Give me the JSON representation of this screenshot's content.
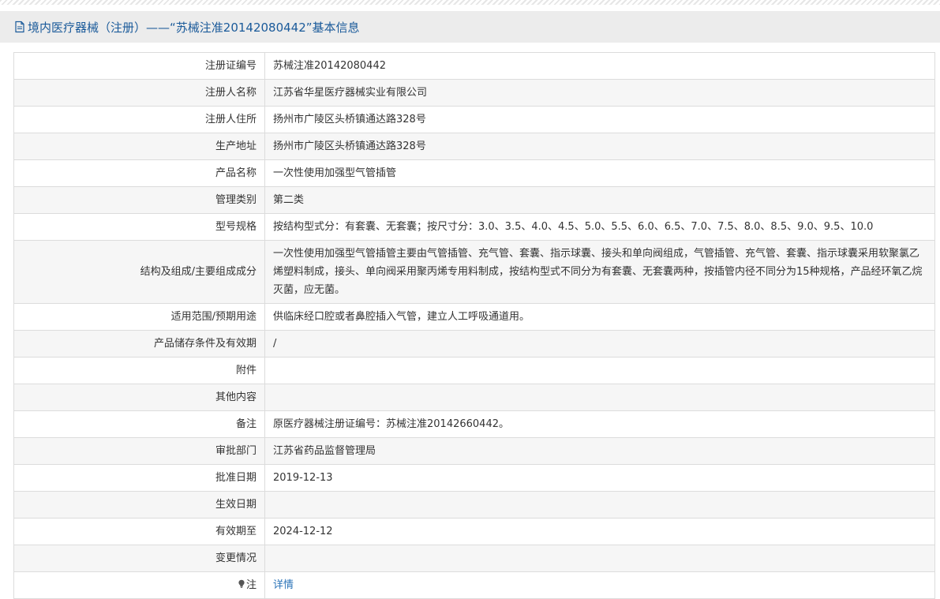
{
  "header": {
    "title": "境内医疗器械（注册）——“苏械注准20142080442”基本信息"
  },
  "rows": [
    {
      "label": "注册证编号",
      "value": "苏械注准20142080442"
    },
    {
      "label": "注册人名称",
      "value": "江苏省华星医疗器械实业有限公司"
    },
    {
      "label": "注册人住所",
      "value": "扬州市广陵区头桥镇通达路328号"
    },
    {
      "label": "生产地址",
      "value": "扬州市广陵区头桥镇通达路328号"
    },
    {
      "label": "产品名称",
      "value": "一次性使用加强型气管插管"
    },
    {
      "label": "管理类别",
      "value": "第二类"
    },
    {
      "label": "型号规格",
      "value": "按结构型式分：有套囊、无套囊；按尺寸分：3.0、3.5、4.0、4.5、5.0、5.5、6.0、6.5、7.0、7.5、8.0、8.5、9.0、9.5、10.0"
    },
    {
      "label": "结构及组成/主要组成成分",
      "value": "一次性使用加强型气管插管主要由气管插管、充气管、套囊、指示球囊、接头和单向阀组成，气管插管、充气管、套囊、指示球囊采用软聚氯乙烯塑料制成，接头、单向阀采用聚丙烯专用料制成，按结构型式不同分为有套囊、无套囊两种，按插管内径不同分为15种规格，产品经环氧乙烷灭菌，应无菌。"
    },
    {
      "label": "适用范围/预期用途",
      "value": "供临床经口腔或者鼻腔插入气管，建立人工呼吸通道用。"
    },
    {
      "label": "产品储存条件及有效期",
      "value": "/"
    },
    {
      "label": "附件",
      "value": ""
    },
    {
      "label": "其他内容",
      "value": ""
    },
    {
      "label": "备注",
      "value": "原医疗器械注册证编号：苏械注准20142660442。"
    },
    {
      "label": "审批部门",
      "value": "江苏省药品监督管理局"
    },
    {
      "label": "批准日期",
      "value": "2019-12-13"
    },
    {
      "label": "生效日期",
      "value": ""
    },
    {
      "label": "有效期至",
      "value": "2024-12-12"
    },
    {
      "label": "变更情况",
      "value": ""
    }
  ],
  "note": {
    "label": "注",
    "link_text": "详情"
  },
  "colors": {
    "title_text": "#1a5a9a",
    "link": "#2a73b8",
    "row_alt": "#f6f6f6",
    "border": "#dcdcdc"
  },
  "icons": [
    "document-icon",
    "lightbulb-icon"
  ]
}
